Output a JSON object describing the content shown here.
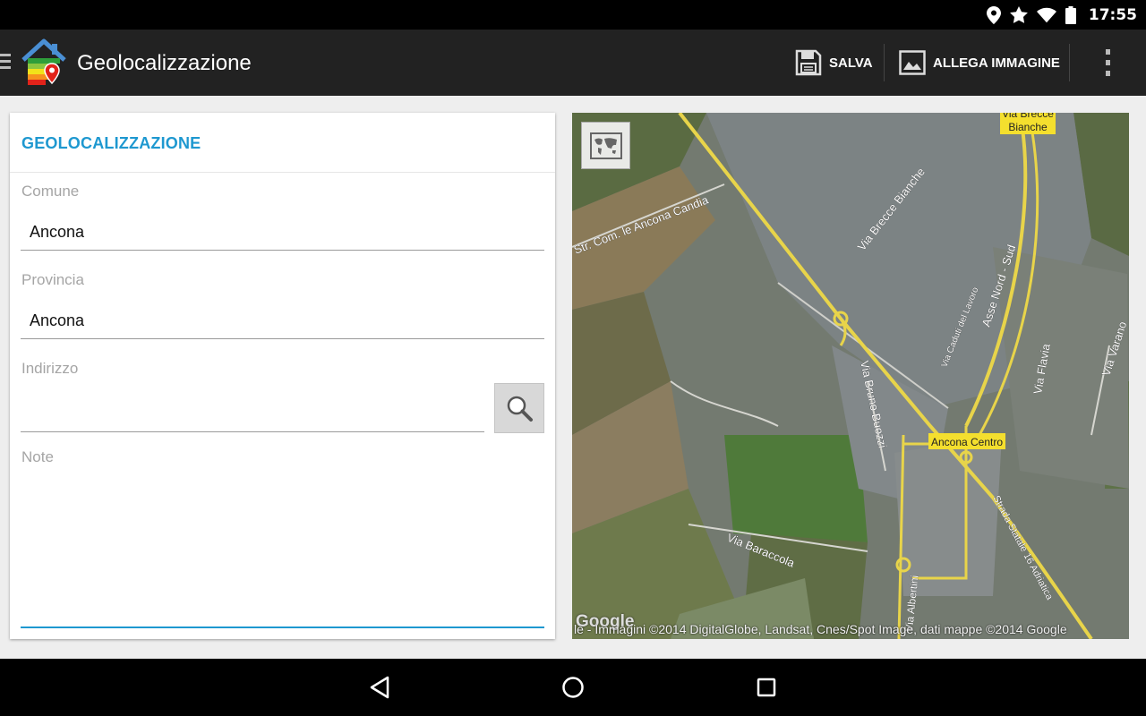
{
  "status_bar": {
    "time": "17:55",
    "icons": [
      "location-icon",
      "star-icon",
      "wifi-icon",
      "battery-icon"
    ]
  },
  "action_bar": {
    "title": "Geolocalizzazione",
    "save_label": "SALVA",
    "attach_label": "ALLEGA IMMAGINE",
    "background": "#222222"
  },
  "form": {
    "section_title": "GEOLOCALIZZAZIONE",
    "accent_color": "#1e98d0",
    "comune": {
      "label": "Comune",
      "value": "Ancona"
    },
    "provincia": {
      "label": "Provincia",
      "value": "Ancona"
    },
    "indirizzo": {
      "label": "Indirizzo",
      "value": ""
    },
    "note": {
      "label": "Note",
      "value": ""
    }
  },
  "map": {
    "labels": {
      "via_brecce_bianche_top": "Via Brecce",
      "via_brecce_bianche_bottom": "Bianche",
      "ancona_centro": "Ancona Centro",
      "str_com_ancona_candia": "Str. Com. le Ancona Candia",
      "via_brecce_bianche_road": "Via Brecce Bianche",
      "asse_nord_sud": "Asse Nord - Sud",
      "via_flavia": "Via Flavia",
      "via_varano": "Via Varano",
      "via_bruno_buozzi": "Via Bruno Buozzi",
      "via_caduti_del_lavoro": "Via Caduti del Lavoro",
      "via_baraccola": "Via Baraccola",
      "strada_statale": "Strada Statale 16 Adriatica",
      "via_albertini": "Via Albertini"
    },
    "google_logo": "Google",
    "attribution": "le - Immagini ©2014 DigitalGlobe, Landsat, Cnes/Spot Image, dati mappe ©2014 Google"
  }
}
